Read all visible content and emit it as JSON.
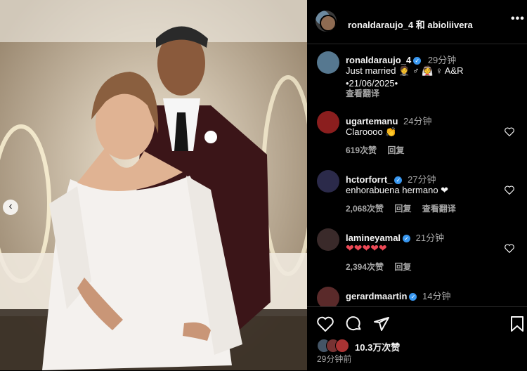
{
  "header": {
    "usernames": "ronaldaraujo_4 和 abioliivera"
  },
  "caption": {
    "username": "ronaldaraujo_4",
    "time": "29分钟",
    "text_line1": "Just married 🤵 ♂ 👰 ♀ A&R",
    "text_line2": "•21/06/2025•",
    "translate": "查看翻译"
  },
  "comments": [
    {
      "username": "ugartemanu",
      "time": "24分钟",
      "text": "Claroooo 👏",
      "likes": "619次赞",
      "reply": "回复"
    },
    {
      "username": "hctorforrt_",
      "time": "27分钟",
      "text": "enhorabuena hermano ❤",
      "likes": "2,068次赞",
      "reply": "回复",
      "translate": "查看翻译"
    },
    {
      "username": "lamineyamal",
      "time": "21分钟",
      "text": "❤❤❤❤❤",
      "likes": "2,394次赞",
      "reply": "回复"
    },
    {
      "username": "gerardmaartin",
      "time": "14分钟",
      "text": ""
    }
  ],
  "footer": {
    "likes": "10.3万次赞",
    "time": "29分钟前"
  },
  "colors": {
    "verified": "#3897f0",
    "heart": "#ed4956",
    "background": "#000000"
  }
}
